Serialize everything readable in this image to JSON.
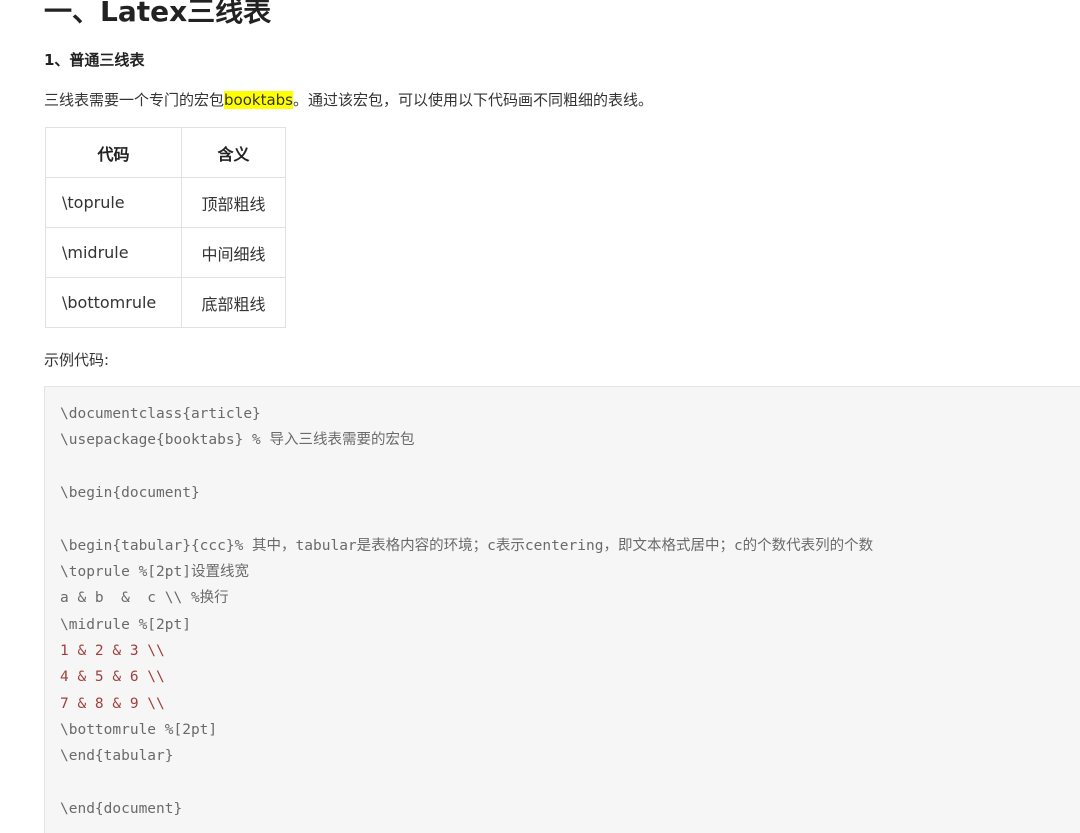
{
  "heading_main": "一、Latex三线表",
  "heading_sub": "1、普通三线表",
  "intro": {
    "before": "三线表需要一个专门的宏包",
    "highlight": "booktabs",
    "after": "。通过该宏包，可以使用以下代码画不同粗细的表线。"
  },
  "table": {
    "headers": [
      "代码",
      "含义"
    ],
    "rows": [
      [
        "\\toprule",
        "顶部粗线"
      ],
      [
        "\\midrule",
        "中间细线"
      ],
      [
        "\\bottomrule",
        "底部粗线"
      ]
    ]
  },
  "example_label": "示例代码:",
  "code_lines": [
    "\\documentclass{article}",
    "\\usepackage{booktabs} % 导入三线表需要的宏包",
    "",
    "\\begin{document}",
    "",
    "\\begin{tabular}{ccc}% 其中，tabular是表格内容的环境；c表示centering，即文本格式居中；c的个数代表列的个数",
    "\\toprule %[2pt]设置线宽",
    "a & b  &  c \\\\ %换行",
    "\\midrule %[2pt]",
    "1 & 2 & 3 \\\\",
    "4 & 5 & 6 \\\\",
    "7 & 8 & 9 \\\\",
    "\\bottomrule %[2pt]",
    "\\end{tabular}",
    "",
    "\\end{document}"
  ],
  "colors": {
    "highlight": "#ffff00",
    "code_background": "#f6f6f6",
    "code_text": "#6a6a6a",
    "code_number": "#a0413c",
    "table_border": "#dfe2e5"
  }
}
